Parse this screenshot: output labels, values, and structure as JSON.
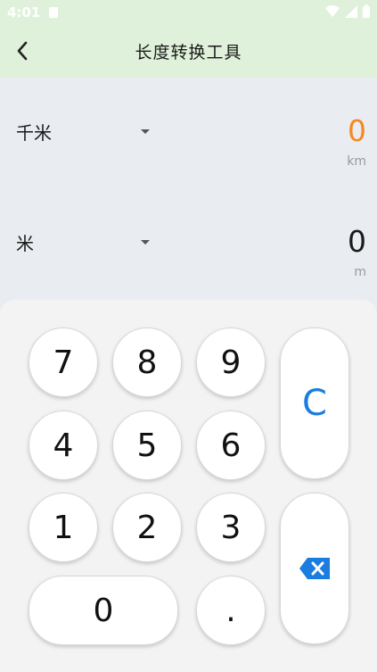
{
  "status": {
    "time": "4:01"
  },
  "appbar": {
    "title": "长度转换工具"
  },
  "rows": [
    {
      "unit": "千米",
      "value": "0",
      "abbr": "km",
      "active": true
    },
    {
      "unit": "米",
      "value": "0",
      "abbr": "m",
      "active": false
    }
  ],
  "keypad": {
    "keys": {
      "k7": "7",
      "k8": "8",
      "k9": "9",
      "k4": "4",
      "k5": "5",
      "k6": "6",
      "k1": "1",
      "k2": "2",
      "k3": "3",
      "k0": "0",
      "dot": "."
    },
    "clear": "C",
    "backspace_icon": "backspace-icon"
  },
  "colors": {
    "accent": "#f5881f",
    "clear": "#1a7de0",
    "header": "#dff1da"
  }
}
